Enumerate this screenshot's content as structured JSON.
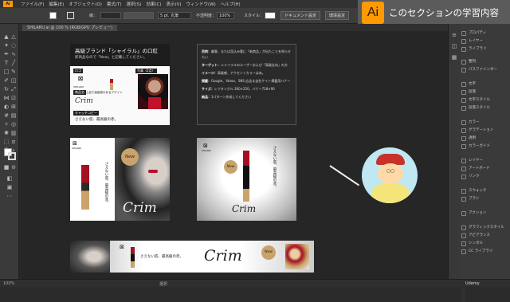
{
  "menubar": {
    "items": [
      "ファイル(F)",
      "編集(E)",
      "オブジェクト(O)",
      "書式(T)",
      "選択(S)",
      "効果(C)",
      "表示(V)",
      "ウィンドウ(W)",
      "ヘルプ(H)"
    ]
  },
  "control_bar": {
    "stroke_label": "線：",
    "brush_value": "5 pt. 丸筆",
    "opacity_label": "不透明度：",
    "opacity_value": "100%",
    "style_label": "スタイル：",
    "doc_settings": "ドキュメント設定",
    "env_settings": "環境設定"
  },
  "brand": {
    "logo": "Ai",
    "title": "このセクションの学習内容"
  },
  "document_tab": {
    "label": "SHILARU.ai @ 100 % (RGB/GPU プレビュー)"
  },
  "artboard_brief": {
    "title": "高級ブランド「シャイラル」の口紅",
    "subtitle": "新商品なので「New」と記載してください。",
    "logo_label": "ロゴ",
    "photo_label": "写真（2点）",
    "product_label": "商品名",
    "product_desc": "上品で高級感のあるデザイン",
    "product_name": "Crim",
    "catch_label": "キャッチコピー",
    "catch_copy": "さえない唇、最高級の赤。"
  },
  "notes": {
    "lines": [
      {
        "k": "目的：",
        "v": "顧客、または見込み客に「新商品」が出たことを知らせたい"
      },
      {
        "k": "ターゲット：",
        "v": "シャイラルのユーザーおよび「高級志向」の方"
      },
      {
        "k": "イメージ：",
        "v": "高級感、アクセントカラーは赤。"
      },
      {
        "k": "掲載：",
        "v": "Google、Yahoo、SNS 広告＆自社サイト掲載用バナー"
      },
      {
        "k": "サイズ：",
        "v": "レクタングル 300×250、バナー728×90"
      },
      {
        "k": "納品：",
        "v": "1パターン作成してください"
      }
    ]
  },
  "banners": {
    "logo_text": "SHILARU",
    "new_badge": "New",
    "product_name": "Crim",
    "catch_copy": "さえない唇、最高級の赤。"
  },
  "right_panel": {
    "items": [
      "プロパティ",
      "レイヤー",
      "ライブラリ",
      "整列",
      "パスファインダー",
      "文字",
      "段落",
      "文字スタイル",
      "段落スタイル",
      "カラー",
      "グラデーション",
      "透明",
      "カラーガイド",
      "レイヤー",
      "アートボード",
      "リンク",
      "スウォッチ",
      "ブラシ",
      "アクション",
      "グラフィックスタイル",
      "アピアランス",
      "シンボル",
      "CC ライブラリ"
    ]
  },
  "statusbar": {
    "zoom": "100%",
    "mode": "選択",
    "watermark": "Udemy"
  },
  "colors": {
    "accent": "#ff9a00",
    "lipstick_red": "#b3122a",
    "gold": "#c9a36a"
  }
}
